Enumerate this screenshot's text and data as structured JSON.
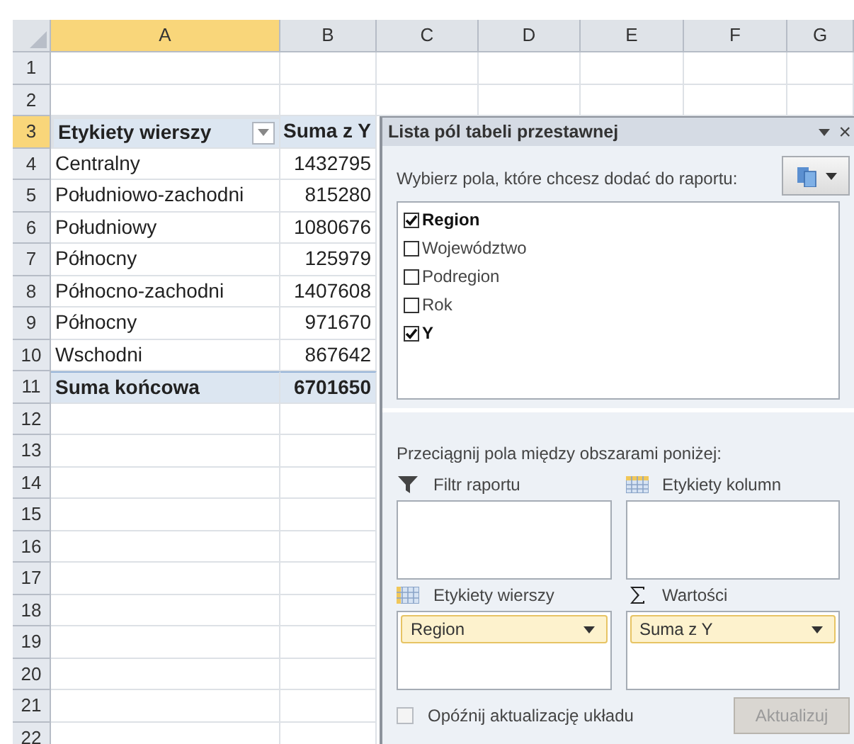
{
  "columns": [
    {
      "label": "A",
      "selected": true
    },
    {
      "label": "B",
      "selected": false
    },
    {
      "label": "C",
      "selected": false
    },
    {
      "label": "D",
      "selected": false
    },
    {
      "label": "E",
      "selected": false
    },
    {
      "label": "F",
      "selected": false
    },
    {
      "label": "G",
      "selected": false
    }
  ],
  "row_numbers": [
    {
      "label": "1",
      "selected": false
    },
    {
      "label": "2",
      "selected": false
    },
    {
      "label": "3",
      "selected": true
    },
    {
      "label": "4",
      "selected": false
    },
    {
      "label": "5",
      "selected": false
    },
    {
      "label": "6",
      "selected": false
    },
    {
      "label": "7",
      "selected": false
    },
    {
      "label": "8",
      "selected": false
    },
    {
      "label": "9",
      "selected": false
    },
    {
      "label": "10",
      "selected": false
    },
    {
      "label": "11",
      "selected": false
    },
    {
      "label": "12",
      "selected": false
    },
    {
      "label": "13",
      "selected": false
    },
    {
      "label": "14",
      "selected": false
    },
    {
      "label": "15",
      "selected": false
    },
    {
      "label": "16",
      "selected": false
    },
    {
      "label": "17",
      "selected": false
    },
    {
      "label": "18",
      "selected": false
    },
    {
      "label": "19",
      "selected": false
    },
    {
      "label": "20",
      "selected": false
    },
    {
      "label": "21",
      "selected": false
    },
    {
      "label": "22",
      "selected": false
    }
  ],
  "pivot": {
    "row_label": "Etykiety wierszy",
    "value_label": "Suma z Y",
    "rows": [
      {
        "label": "Centralny",
        "value": "1432795"
      },
      {
        "label": "Południowo-zachodni",
        "value": "815280"
      },
      {
        "label": "Południowy",
        "value": "1080676"
      },
      {
        "label": "Północny",
        "value": "125979"
      },
      {
        "label": "Północno-zachodni",
        "value": "1407608"
      },
      {
        "label": "Północny",
        "value": "971670"
      },
      {
        "label": "Wschodni",
        "value": "867642"
      }
    ],
    "total": {
      "label": "Suma końcowa",
      "value": "6701650"
    }
  },
  "panel": {
    "title": "Lista pól tabeli przestawnej",
    "close": "×",
    "prompt": "Wybierz pola, które chcesz dodać do raportu:",
    "fields": [
      {
        "label": "Region",
        "checked": true
      },
      {
        "label": "Województwo",
        "checked": false
      },
      {
        "label": "Podregion",
        "checked": false
      },
      {
        "label": "Rok",
        "checked": false
      },
      {
        "label": "Y",
        "checked": true
      }
    ],
    "drag_prompt": "Przeciągnij pola między obszarami poniżej:",
    "areas": [
      {
        "kind": "filter",
        "label": "Filtr raportu"
      },
      {
        "kind": "columns",
        "label": "Etykiety kolumn"
      },
      {
        "kind": "rows",
        "label": "Etykiety wierszy",
        "items": [
          "Region"
        ]
      },
      {
        "kind": "values",
        "label": "Wartości",
        "items": [
          "Suma z Y"
        ]
      }
    ],
    "defer": {
      "label": "Opóźnij aktualizację układu",
      "checked": false
    },
    "update_button": {
      "label": "Aktualizuj",
      "disabled": true
    }
  }
}
